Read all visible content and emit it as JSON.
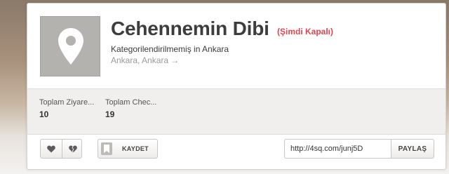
{
  "venue": {
    "name": "Cehennemin Dibi",
    "status": "(Şimdi Kapalı)",
    "category": "Kategorilendirilmemiş in Ankara",
    "location": "Ankara, Ankara",
    "location_arrow": "→",
    "icon": "map-pin-icon"
  },
  "stats": [
    {
      "label": "Toplam Ziyare...",
      "value": "10"
    },
    {
      "label": "Toplam Chec...",
      "value": "19"
    }
  ],
  "actions": {
    "like_icon": "heart-icon",
    "dislike_icon": "broken-heart-icon",
    "save_label": "KAYDET",
    "share_url": "http://4sq.com/junj5D",
    "share_label": "PAYLAŞ"
  },
  "colors": {
    "status_red": "#e0454f",
    "title": "#3d3d3d",
    "placeholder_bg": "#b4b2ae"
  }
}
